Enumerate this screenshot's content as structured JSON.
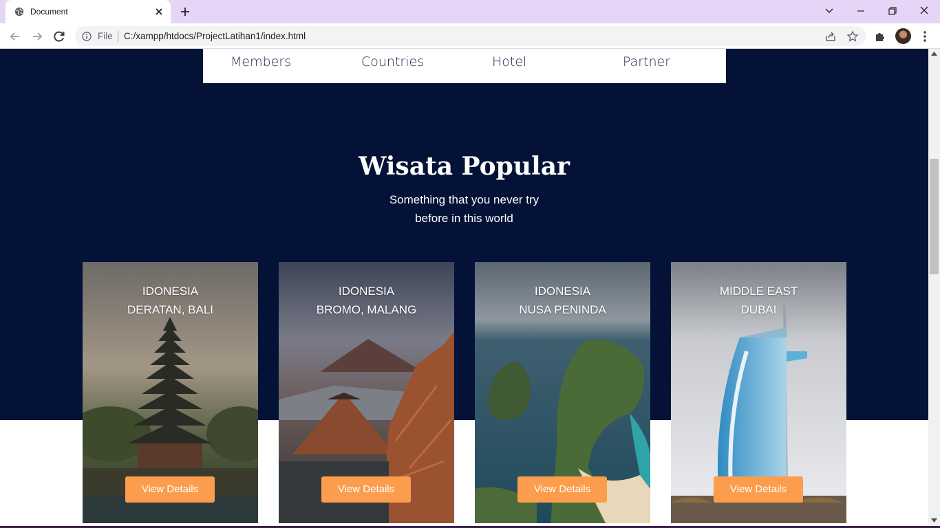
{
  "browser": {
    "tab_title": "Document",
    "omnibox": {
      "file_label": "File",
      "url": "C:/xampp/htdocs/ProjectLatihan1/index.html"
    },
    "icons": [
      "globe-icon",
      "close-icon",
      "plus-icon",
      "chevron-down-icon",
      "minimize-icon",
      "restore-icon",
      "close-window-icon",
      "back-icon",
      "forward-icon",
      "reload-icon",
      "info-icon",
      "share-icon",
      "star-icon",
      "puzzle-icon",
      "kebab-menu-icon"
    ]
  },
  "stats": {
    "items": [
      {
        "label": "Members"
      },
      {
        "label": "Countries"
      },
      {
        "label": "Hotel"
      },
      {
        "label": "Partner"
      }
    ]
  },
  "section": {
    "title": "Wisata Popular",
    "subtitle_line1": "Something that you never try",
    "subtitle_line2": "before in this world"
  },
  "cards": [
    {
      "region": "IDONESIA",
      "place": "DERATAN, BALI",
      "button": "View Details"
    },
    {
      "region": "IDONESIA",
      "place": "BROMO, MALANG",
      "button": "View Details"
    },
    {
      "region": "IDONESIA",
      "place": "NUSA PENINDA",
      "button": "View Details"
    },
    {
      "region": "MIDDLE EAST",
      "place": "DUBAI",
      "button": "View Details"
    }
  ],
  "colors": {
    "hero_bg": "#031236",
    "accent_button": "#fb9d4c",
    "tabbar": "#e6d5f6"
  }
}
